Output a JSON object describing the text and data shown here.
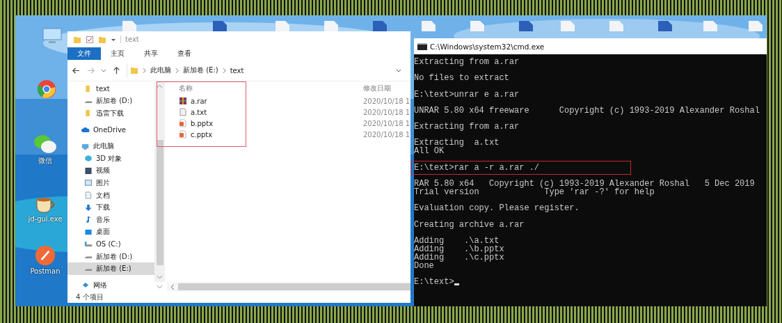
{
  "desktop": {
    "icons": [
      {
        "label": "微信",
        "kind": "chat"
      },
      {
        "label": "jd-gui.exe",
        "kind": "cup"
      },
      {
        "label": "Postman",
        "kind": "rocket"
      }
    ]
  },
  "explorer": {
    "title": "text",
    "ribbon_tabs": [
      {
        "label": "文件",
        "selected": true
      },
      {
        "label": "主页",
        "selected": false
      },
      {
        "label": "共享",
        "selected": false
      },
      {
        "label": "查看",
        "selected": false
      }
    ],
    "breadcrumb": [
      "此电脑",
      "新加卷 (E:)",
      "text"
    ],
    "nav_items": [
      {
        "label": "text",
        "kind": "folder",
        "selected": false
      },
      {
        "label": "新加卷 (D:)",
        "kind": "drive",
        "selected": false
      },
      {
        "label": "迅雷下载",
        "kind": "folder",
        "selected": false
      },
      {
        "label": "OneDrive",
        "kind": "cloud",
        "selected": false
      },
      {
        "label": "此电脑",
        "kind": "pc",
        "selected": false
      },
      {
        "label": "3D 对象",
        "kind": "cube",
        "selected": false
      },
      {
        "label": "视频",
        "kind": "video",
        "selected": false
      },
      {
        "label": "图片",
        "selected": false
      },
      {
        "label": "文档",
        "kind": "doc",
        "selected": false
      },
      {
        "label": "下载",
        "kind": "download",
        "selected": false
      },
      {
        "label": "音乐",
        "kind": "music",
        "selected": false
      },
      {
        "label": "桌面",
        "kind": "desktop",
        "selected": false
      },
      {
        "label": "OS (C:)",
        "kind": "osdrive",
        "selected": false
      },
      {
        "label": "新加卷 (D:)",
        "kind": "drive",
        "selected": false
      },
      {
        "label": "新加卷 (E:)",
        "kind": "drive",
        "selected": true
      },
      {
        "label": "网络",
        "kind": "network",
        "selected": false
      }
    ],
    "columns": [
      "名称",
      "修改日期"
    ],
    "files": [
      {
        "name": "a.rar",
        "kind": "rar",
        "date": "2020/10/18 1"
      },
      {
        "name": "a.txt",
        "kind": "txt",
        "date": "2020/10/18 1"
      },
      {
        "name": "b.pptx",
        "kind": "pptx",
        "date": "2020/10/18 1"
      },
      {
        "name": "c.pptx",
        "kind": "pptx",
        "date": "2020/10/18 1"
      }
    ],
    "status": "4 个项目"
  },
  "console": {
    "title": "C:\\Windows\\system32\\cmd.exe",
    "blocks": [
      [
        {
          "text": "Extracting from a.rar",
          "highlighted": false
        }
      ],
      [
        {
          "text": "No files to extract",
          "highlighted": false
        }
      ],
      [
        {
          "text": "E:\\text>unrar e a.rar",
          "highlighted": false
        }
      ],
      [
        {
          "text": "UNRAR 5.80 x64 freeware      Copyright (c) 1993-2019 Alexander Roshal",
          "highlighted": false
        }
      ],
      [
        {
          "text": "Extracting from a.rar",
          "highlighted": false
        }
      ],
      [
        {
          "text": "Extracting  a.txt",
          "highlighted": false
        },
        {
          "text": "All OK",
          "highlighted": false
        }
      ],
      [
        {
          "text": "E:\\text>rar a -r a.rar ./",
          "highlighted": true
        }
      ],
      [
        {
          "text": "RAR 5.80 x64   Copyright (c) 1993-2019 Alexander Roshal   5 Dec 2019",
          "highlighted": false
        },
        {
          "text": "Trial version             Type 'rar -?' for help",
          "highlighted": false
        }
      ],
      [
        {
          "text": "Evaluation copy. Please register.",
          "highlighted": false
        }
      ],
      [
        {
          "text": "Creating archive a.rar",
          "highlighted": false
        }
      ],
      [
        {
          "text": "Adding    .\\a.txt",
          "highlighted": false
        },
        {
          "text": "Adding    .\\b.pptx",
          "highlighted": false
        },
        {
          "text": "Adding    .\\c.pptx",
          "highlighted": false
        },
        {
          "text": "Done",
          "highlighted": false
        }
      ]
    ],
    "prompt": "E:\\text>"
  }
}
